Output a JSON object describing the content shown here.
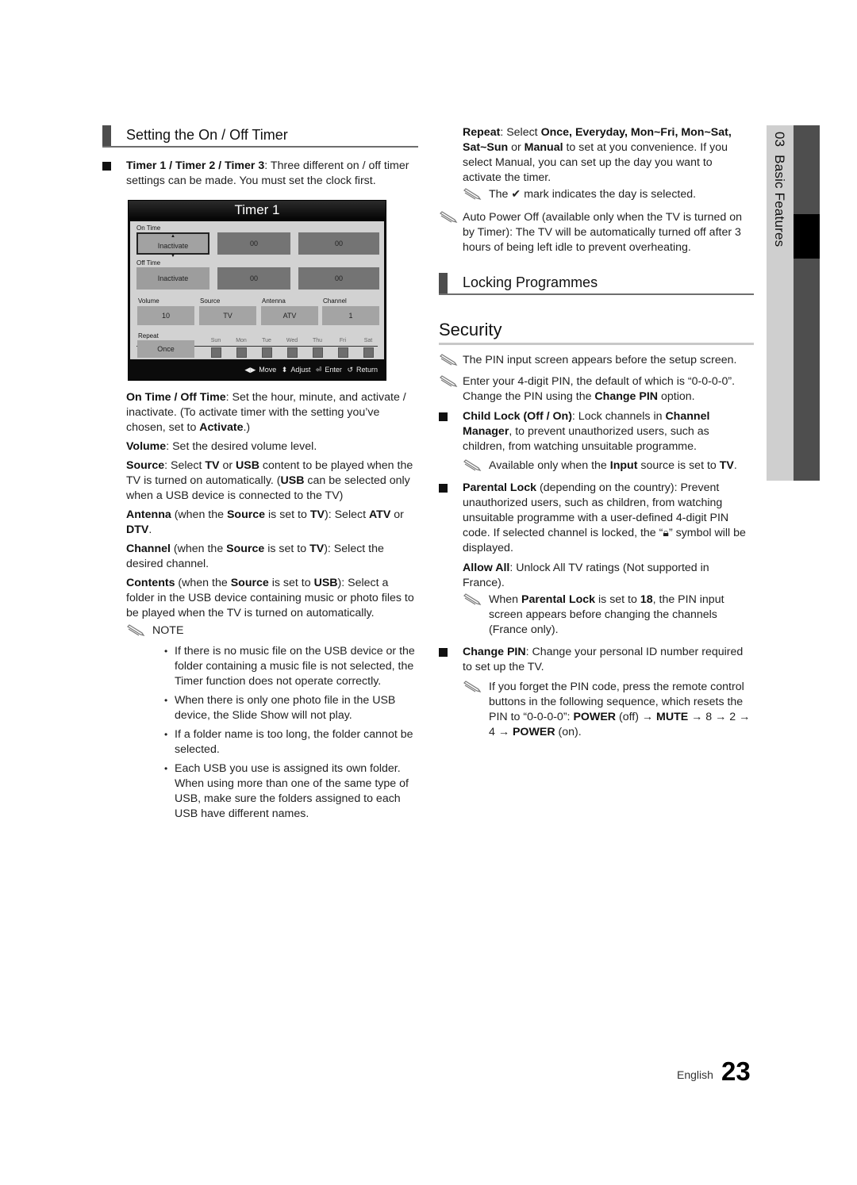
{
  "sections": {
    "timer_title": "Setting the On / Off Timer",
    "locking_title": "Locking Programmes",
    "security_title": "Security"
  },
  "timer_intro": {
    "bold": "Timer 1 / Timer 2 / Timer 3",
    "text": ": Three different on / off timer settings can be made. You must set the clock first."
  },
  "osd": {
    "title": "Timer 1",
    "on_time_label": "On Time",
    "on_time_state": "Inactivate",
    "on_time_hour": "00",
    "on_time_min": "00",
    "off_time_label": "Off Time",
    "off_time_state": "Inactivate",
    "off_time_hour": "00",
    "off_time_min": "00",
    "volume_label": "Volume",
    "volume_value": "10",
    "source_label": "Source",
    "source_value": "TV",
    "antenna_label": "Antenna",
    "antenna_value": "ATV",
    "channel_label": "Channel",
    "channel_value": "1",
    "repeat_label": "Repeat",
    "repeat_value": "Once",
    "days": [
      "Sun",
      "Mon",
      "Tue",
      "Wed",
      "Thu",
      "Fri",
      "Sat"
    ],
    "footer": {
      "move": "Move",
      "adjust": "Adjust",
      "enter": "Enter",
      "return": "Return"
    }
  },
  "left_paras": [
    {
      "b1": "On Time / Off Time",
      "t1": ": Set the hour, minute, and activate / inactivate. (To activate timer with the setting you’ve chosen, set to ",
      "b2": "Activate",
      "t2": ".)"
    },
    {
      "b1": "Volume",
      "t1": ": Set the desired volume level."
    }
  ],
  "source_para": {
    "b1": "Source",
    "t1": ": Select ",
    "b2": "TV",
    "t2": " or ",
    "b3": "USB",
    "t3": " content to be played when the TV is turned on automatically. (",
    "b4": "USB",
    "t4": " can be selected only when a USB device is connected to the TV)"
  },
  "antenna_para": {
    "b1": "Antenna",
    "t1": " (when the ",
    "b2": "Source",
    "t2": " is set to ",
    "b3": "TV",
    "t3": "): Select ",
    "b4": "ATV",
    "t4": " or ",
    "b5": "DTV",
    "t5": "."
  },
  "channel_para": {
    "b1": "Channel",
    "t1": " (when the ",
    "b2": "Source",
    "t2": " is set to ",
    "b3": "TV",
    "t3": "): Select the desired channel."
  },
  "contents_para": {
    "b1": "Contents",
    "t1": " (when the ",
    "b2": "Source",
    "t2": " is set to ",
    "b3": "USB",
    "t3": "): Select a folder in the USB device containing music or photo files to be played when the TV is turned on automatically."
  },
  "note_label": "NOTE",
  "notes": [
    "If there is no music file on the USB device or the folder containing a music file is not selected, the Timer function does not operate correctly.",
    "When there is only one photo file in the USB device, the Slide Show will not play.",
    "If a folder name is too long, the folder cannot be selected.",
    "Each USB you use is assigned its own folder. When using more than one of the same type of USB, make sure the folders assigned to each USB have different names."
  ],
  "repeat_para": {
    "b1": "Repeat",
    "t1": ": Select ",
    "b2": "Once, Everyday, Mon~Fri, Mon~Sat, Sat~Sun",
    "t2": " or ",
    "b3": "Manual",
    "t3": " to set at you convenience. If you select Manual, you can set up the day you want to activate the timer."
  },
  "check_note": {
    "t1": "The ",
    "t2": " mark indicates the day is selected."
  },
  "auto_power_note": "Auto Power Off (available only when the TV is turned on by Timer): The TV will be automatically turned off after 3 hours of being left idle to prevent overheating.",
  "security_notes": [
    "The PIN input screen appears before the setup screen."
  ],
  "pin_note": {
    "t1": "Enter your 4-digit PIN, the default of which is “0-0-0-0”. Change the PIN using the ",
    "b1": "Change PIN",
    "t2": " option."
  },
  "child_lock": {
    "b1": "Child Lock (Off / On)",
    "t1": ": Lock channels in ",
    "b2": "Channel Manager",
    "t2": ", to prevent unauthorized users, such as children, from watching unsuitable programme."
  },
  "child_note": {
    "t1": "Available only when the ",
    "b1": "Input",
    "t2": " source is set to ",
    "b2": "TV",
    "t3": "."
  },
  "parental_lock": {
    "b1": "Parental Lock",
    "t1": " (depending on the country): Prevent unauthorized users, such as children, from watching unsuitable programme with a user-defined 4-digit PIN code. If selected channel is locked, the “",
    "t2": "” symbol will be displayed."
  },
  "allow_all": {
    "b1": "Allow All",
    "t1": ": Unlock All TV ratings (Not supported in France)."
  },
  "parental_note": {
    "t1": "When ",
    "b1": "Parental Lock",
    "t2": " is set to ",
    "b2": "18",
    "t3": ", the PIN input screen appears before changing the channels (France only)."
  },
  "change_pin": {
    "b1": "Change PIN",
    "t1": ": Change your personal ID number required to set up the TV."
  },
  "change_pin_note": {
    "t1": "If you forget the PIN code, press the remote control buttons in the following sequence, which resets the PIN to “0-0-0-0”: ",
    "b1": "POWER",
    "t2": " (off) → ",
    "b2": "MUTE",
    "t3": " → 8 → 2 → 4 → ",
    "b3": "POWER",
    "t4": " (on)."
  },
  "side_tab": {
    "chapter": "03",
    "label": "Basic Features"
  },
  "footer": {
    "language": "English",
    "page": "23"
  }
}
